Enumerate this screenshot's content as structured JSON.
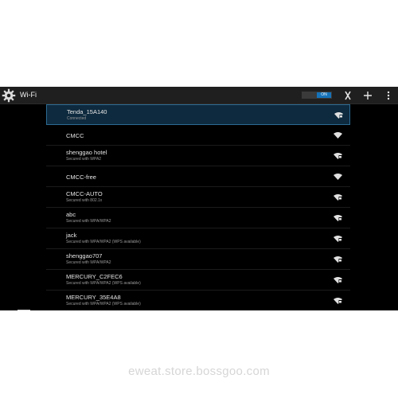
{
  "actionbar": {
    "title": "Wi-Fi",
    "toggle_label": "ON"
  },
  "networks": [
    {
      "ssid": "Tenda_15A140",
      "status": "Connected",
      "icon": "wifi-lock-icon",
      "selected": true
    },
    {
      "ssid": "CMCC",
      "status": "",
      "icon": "wifi-icon",
      "selected": false
    },
    {
      "ssid": "shenggao hotel",
      "status": "Secured with WPA2",
      "icon": "wifi-lock-icon",
      "selected": false
    },
    {
      "ssid": "CMCC-free",
      "status": "",
      "icon": "wifi-icon",
      "selected": false
    },
    {
      "ssid": "CMCC-AUTO",
      "status": "Secured with 802.1x",
      "icon": "wifi-lock-icon",
      "selected": false
    },
    {
      "ssid": "abc",
      "status": "Secured with WPA/WPA2",
      "icon": "wifi-lock-icon",
      "selected": false
    },
    {
      "ssid": "jack",
      "status": "Secured with WPA/WPA2 (WPS available)",
      "icon": "wifi-lock-icon",
      "selected": false
    },
    {
      "ssid": "shenggao707",
      "status": "Secured with WPA/WPA2",
      "icon": "wifi-lock-icon",
      "selected": false
    },
    {
      "ssid": "MERCURY_C2FEC6",
      "status": "Secured with WPA/WPA2 (WPS available)",
      "icon": "wifi-lock-icon",
      "selected": false
    },
    {
      "ssid": "MERCURY_35E4A8",
      "status": "Secured with WPA/WPA2 (WPS available)",
      "icon": "wifi-lock-icon",
      "selected": false
    }
  ],
  "watermark": "eweat.store.bossgoo.com",
  "colors": {
    "accent": "#1572b8",
    "selected_bg": "#0e2a3e",
    "background": "#000000",
    "actionbar_bg": "#1f1f1f"
  }
}
